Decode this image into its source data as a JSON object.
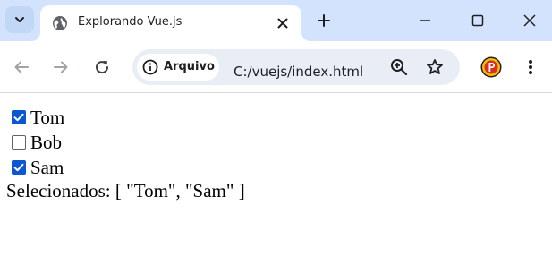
{
  "browser": {
    "tab": {
      "title": "Explorando Vue.js"
    },
    "omnibox": {
      "site_label": "Arquivo",
      "url": "C:/vuejs/index.html"
    }
  },
  "page": {
    "checkboxes": [
      {
        "label": "Tom",
        "checked": true
      },
      {
        "label": "Bob",
        "checked": false
      },
      {
        "label": "Sam",
        "checked": true
      }
    ],
    "selected_text": "Selecionados: [ \"Tom\", \"Sam\" ]"
  },
  "colors": {
    "tabstrip_bg": "#d3e3fd",
    "checkbox_accent": "#0b57d0",
    "extension_red": "#d93025",
    "extension_yellow": "#fbbc04"
  },
  "icons": {
    "tab_search": "chevron-down-icon",
    "favicon": "globe-icon",
    "tab_close": "close-icon",
    "new_tab": "plus-icon",
    "minimize": "minimize-icon",
    "maximize": "maximize-icon",
    "close_window": "close-icon",
    "back": "arrow-left-icon",
    "forward": "arrow-right-icon",
    "reload": "reload-icon",
    "site_info": "info-icon",
    "zoom": "zoom-in-icon",
    "bookmark": "star-icon",
    "extension": "extension-p-icon",
    "menu": "kebab-menu-icon"
  }
}
